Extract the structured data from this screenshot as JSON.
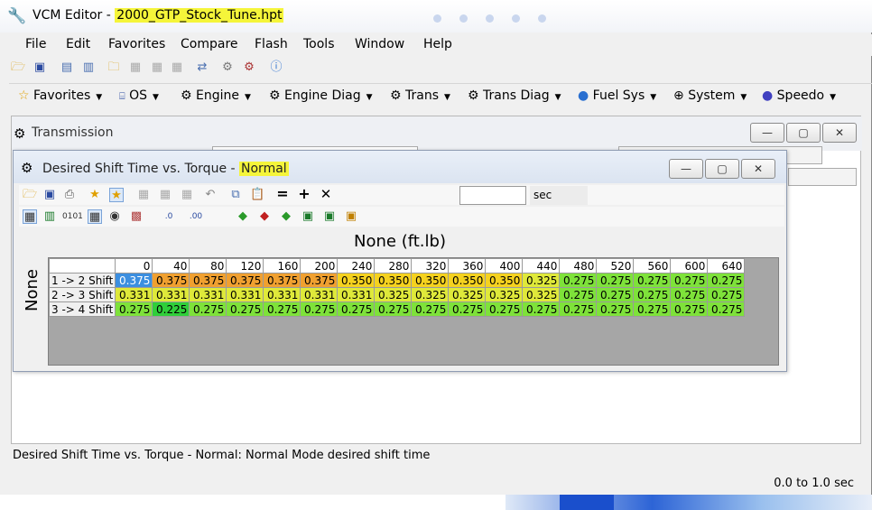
{
  "window": {
    "title_prefix": "VCM Editor - ",
    "title_file": "2000_GTP_Stock_Tune.hpt"
  },
  "menu": [
    "File",
    "Edit",
    "Favorites",
    "Compare",
    "Flash",
    "Tools",
    "Window",
    "Help"
  ],
  "toolbar2": [
    "Favorites",
    "OS",
    "Engine",
    "Engine Diag",
    "Trans",
    "Trans Diag",
    "Fuel Sys",
    "System",
    "Speedo"
  ],
  "mdi": {
    "title": "Transmission"
  },
  "child": {
    "title_prefix": "Desired Shift Time vs. Torque - ",
    "title_mode": "Normal",
    "sec_label": "sec",
    "x_axis_title": "None (ft.lb)",
    "y_axis_title": "None",
    "col_headers": [
      "0",
      "40",
      "80",
      "120",
      "160",
      "200",
      "240",
      "280",
      "320",
      "360",
      "400",
      "440",
      "480",
      "520",
      "560",
      "600",
      "640"
    ],
    "rows": [
      {
        "label": "1 -> 2 Shift",
        "values": [
          "0.375",
          "0.375",
          "0.375",
          "0.375",
          "0.375",
          "0.375",
          "0.350",
          "0.350",
          "0.350",
          "0.350",
          "0.350",
          "0.325",
          "0.275",
          "0.275",
          "0.275",
          "0.275",
          "0.275"
        ]
      },
      {
        "label": "2 -> 3 Shift",
        "values": [
          "0.331",
          "0.331",
          "0.331",
          "0.331",
          "0.331",
          "0.331",
          "0.331",
          "0.325",
          "0.325",
          "0.325",
          "0.325",
          "0.325",
          "0.275",
          "0.275",
          "0.275",
          "0.275",
          "0.275"
        ]
      },
      {
        "label": "3 -> 4 Shift",
        "values": [
          "0.275",
          "0.225",
          "0.275",
          "0.275",
          "0.275",
          "0.275",
          "0.275",
          "0.275",
          "0.275",
          "0.275",
          "0.275",
          "0.275",
          "0.275",
          "0.275",
          "0.275",
          "0.275",
          "0.275"
        ]
      }
    ],
    "selected_cell": {
      "row": 0,
      "col": 0
    }
  },
  "status": {
    "description": "Desired Shift Time vs. Torque - Normal: Normal Mode desired shift time",
    "range": "0.0 to 1.0 sec"
  },
  "colors": {
    "highlight": "#f5f53a",
    "val_0.375": "#f0a030",
    "val_0.350": "#f5d21f",
    "val_0.331": "#dfe93a",
    "val_0.325": "#dfe93a",
    "val_0.275": "#7ee23a",
    "val_0.225": "#2fcf3a",
    "selected": "#3c8fe0"
  }
}
